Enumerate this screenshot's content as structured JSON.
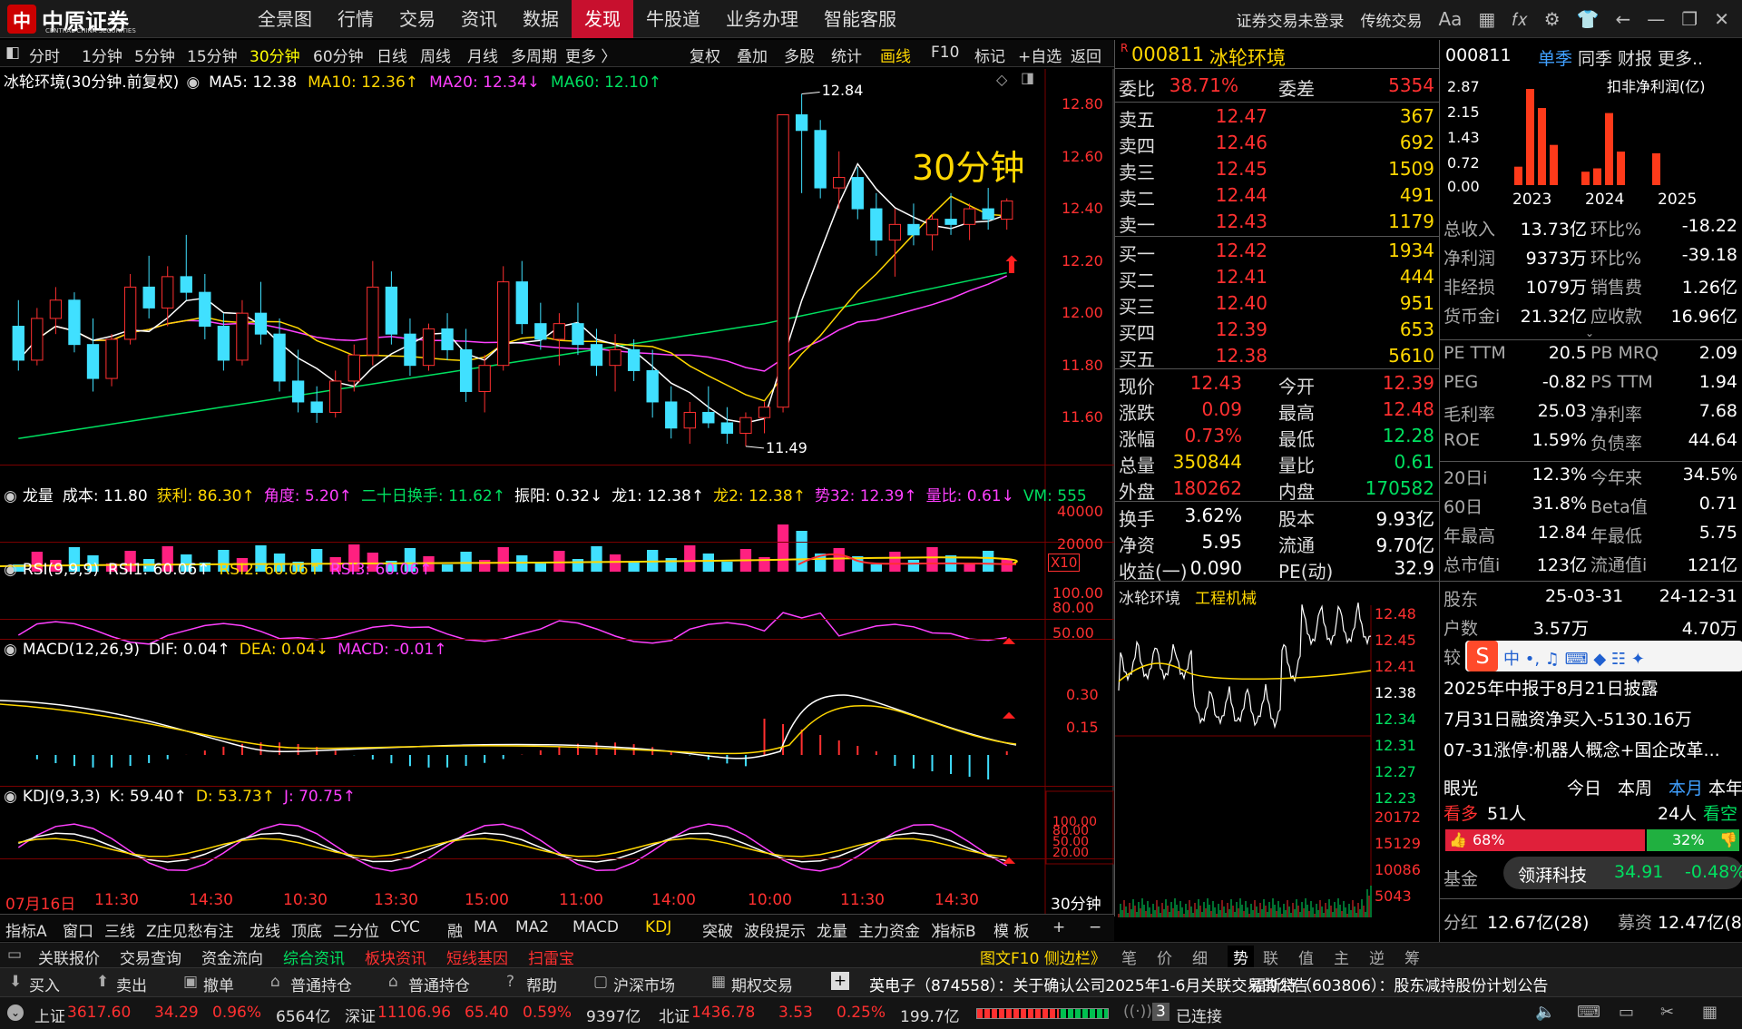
{
  "app": {
    "brand": "中原证券",
    "brand_sub": "CENTRAL CHINA SECURITIES",
    "nav": [
      "全景图",
      "行情",
      "交易",
      "资讯",
      "数据",
      "发现",
      "牛股道",
      "业务办理",
      "智能客服"
    ],
    "nav_active": "发现",
    "login_status": "证券交易未登录",
    "trad_trade": "传统交易",
    "font_btn": "Aa"
  },
  "toolbar": {
    "periods": [
      "分时",
      "1分钟",
      "5分钟",
      "15分钟",
      "30分钟",
      "60分钟",
      "日线",
      "周线",
      "月线",
      "多周期",
      "更多 〉"
    ],
    "active_period": "30分钟",
    "actions": [
      "复权",
      "叠加",
      "多股",
      "统计",
      "画线",
      "F10",
      "标记",
      "+自选",
      "返回"
    ]
  },
  "main_chart": {
    "title": "冰轮环境(30分钟.前复权)",
    "ma": [
      {
        "label": "MA5: 12.38",
        "color": "#ffffff"
      },
      {
        "label": "MA10: 12.36↑",
        "color": "#ffd700"
      },
      {
        "label": "MA20: 12.34↓",
        "color": "#ff40ff"
      },
      {
        "label": "MA60: 12.10↑",
        "color": "#00e060"
      }
    ],
    "overlay_label": "30分钟",
    "high_mark": "12.84",
    "low_mark": "11.49",
    "y_ticks": [
      "12.80",
      "12.60",
      "12.40",
      "12.20",
      "12.00",
      "11.80",
      "11.60"
    ],
    "x_labels": [
      "07月16日",
      "11:30",
      "14:30",
      "10:30",
      "13:30",
      "15:00",
      "11:00",
      "14:00",
      "10:00",
      "11:30",
      "14:30"
    ],
    "period_footer": "30分钟"
  },
  "chart_data": {
    "type": "candlestick",
    "ylim": [
      11.42,
      12.88
    ],
    "ohlc": [
      [
        11.95,
        12.05,
        11.78,
        11.82
      ],
      [
        11.82,
        12.02,
        11.8,
        11.98
      ],
      [
        11.98,
        12.1,
        11.92,
        12.05
      ],
      [
        12.05,
        12.08,
        11.85,
        11.88
      ],
      [
        11.88,
        11.98,
        11.7,
        11.75
      ],
      [
        11.75,
        11.92,
        11.72,
        11.9
      ],
      [
        11.9,
        12.15,
        11.88,
        12.1
      ],
      [
        12.1,
        12.22,
        11.98,
        12.02
      ],
      [
        12.02,
        12.18,
        11.95,
        12.14
      ],
      [
        12.14,
        12.3,
        12.05,
        12.08
      ],
      [
        12.08,
        12.15,
        11.9,
        11.95
      ],
      [
        11.95,
        12.0,
        11.78,
        11.82
      ],
      [
        11.82,
        12.05,
        11.8,
        12.0
      ],
      [
        12.0,
        12.12,
        11.88,
        11.92
      ],
      [
        11.92,
        11.98,
        11.7,
        11.74
      ],
      [
        11.74,
        11.86,
        11.62,
        11.66
      ],
      [
        11.66,
        11.72,
        11.58,
        11.62
      ],
      [
        11.62,
        11.78,
        11.6,
        11.74
      ],
      [
        11.74,
        11.88,
        11.7,
        11.84
      ],
      [
        11.84,
        12.2,
        11.8,
        12.1
      ],
      [
        12.1,
        12.16,
        11.88,
        11.92
      ],
      [
        11.92,
        11.98,
        11.76,
        11.8
      ],
      [
        11.8,
        11.96,
        11.78,
        11.94
      ],
      [
        11.94,
        12.0,
        11.82,
        11.86
      ],
      [
        11.86,
        11.94,
        11.66,
        11.7
      ],
      [
        11.7,
        11.84,
        11.62,
        11.8
      ],
      [
        11.8,
        12.18,
        11.78,
        12.12
      ],
      [
        12.12,
        12.2,
        11.92,
        11.96
      ],
      [
        11.96,
        12.04,
        11.86,
        11.9
      ],
      [
        11.9,
        12.0,
        11.8,
        11.96
      ],
      [
        11.96,
        12.04,
        11.84,
        11.88
      ],
      [
        11.88,
        11.94,
        11.76,
        11.8
      ],
      [
        11.8,
        11.92,
        11.7,
        11.86
      ],
      [
        11.86,
        11.9,
        11.74,
        11.78
      ],
      [
        11.78,
        11.86,
        11.6,
        11.66
      ],
      [
        11.66,
        11.72,
        11.52,
        11.56
      ],
      [
        11.56,
        11.66,
        11.5,
        11.62
      ],
      [
        11.62,
        11.72,
        11.56,
        11.58
      ],
      [
        11.58,
        11.64,
        11.5,
        11.54
      ],
      [
        11.54,
        11.62,
        11.49,
        11.6
      ],
      [
        11.6,
        11.66,
        11.54,
        11.64
      ],
      [
        11.64,
        12.76,
        11.62,
        12.76
      ],
      [
        12.76,
        12.84,
        12.46,
        12.7
      ],
      [
        12.7,
        12.74,
        12.44,
        12.48
      ],
      [
        12.48,
        12.62,
        12.4,
        12.52
      ],
      [
        12.52,
        12.56,
        12.36,
        12.4
      ],
      [
        12.4,
        12.46,
        12.22,
        12.28
      ],
      [
        12.28,
        12.4,
        12.14,
        12.34
      ],
      [
        12.34,
        12.42,
        12.26,
        12.3
      ],
      [
        12.3,
        12.38,
        12.24,
        12.36
      ],
      [
        12.36,
        12.46,
        12.3,
        12.34
      ],
      [
        12.34,
        12.42,
        12.28,
        12.4
      ],
      [
        12.4,
        12.48,
        12.32,
        12.36
      ],
      [
        12.36,
        12.44,
        12.32,
        12.43
      ]
    ]
  },
  "vol_pane": {
    "header": [
      {
        "t": "龙量",
        "c": "#ffffff"
      },
      {
        "t": "成本: 11.80",
        "c": "#ffffff"
      },
      {
        "t": "获利: 86.30↑",
        "c": "#ffd700"
      },
      {
        "t": "角度: 5.20↑",
        "c": "#ff40ff"
      },
      {
        "t": "二十日换手: 11.62↑",
        "c": "#00e060"
      },
      {
        "t": "振阳: 0.32↓",
        "c": "#ffffff"
      },
      {
        "t": "龙1: 12.38↑",
        "c": "#ffffff"
      },
      {
        "t": "龙2: 12.38↑",
        "c": "#ffd700"
      },
      {
        "t": "势32: 12.39↑",
        "c": "#ff40ff"
      },
      {
        "t": "量比: 0.61↓",
        "c": "#ff40ff"
      },
      {
        "t": "VM: 555",
        "c": "#00e060"
      }
    ],
    "y_ticks": [
      "40000",
      "20000"
    ],
    "mult": "X10"
  },
  "rsi_pane": {
    "header": [
      {
        "t": "RSI(9,9,9)",
        "c": "#ffffff"
      },
      {
        "t": "RSI1: 60.06↑",
        "c": "#ffffff"
      },
      {
        "t": "RSI2: 60.06↑",
        "c": "#ffd700"
      },
      {
        "t": "RSI3: 60.06↑",
        "c": "#ff40ff"
      }
    ],
    "y_ticks": [
      "100.00",
      "80.00",
      "50.00"
    ]
  },
  "macd_pane": {
    "header": [
      {
        "t": "MACD(12,26,9)",
        "c": "#ffffff"
      },
      {
        "t": "DIF: 0.04↑",
        "c": "#ffffff"
      },
      {
        "t": "DEA: 0.04↓",
        "c": "#ffd700"
      },
      {
        "t": "MACD: -0.01↑",
        "c": "#ff40ff"
      }
    ],
    "y_ticks": [
      "0.30",
      "0.15"
    ]
  },
  "kdj_pane": {
    "header": [
      {
        "t": "KDJ(9,3,3)",
        "c": "#ffffff"
      },
      {
        "t": "K: 59.40↑",
        "c": "#ffffff"
      },
      {
        "t": "D: 53.73↑",
        "c": "#ffd700"
      },
      {
        "t": "J: 70.75↑",
        "c": "#ff40ff"
      }
    ],
    "y_ticks": [
      "100.00",
      "80.00",
      "50.00",
      "20.00"
    ]
  },
  "bottom_tabs": [
    "指标A",
    "窗口",
    "三线",
    "Z庄见愁有注",
    "龙线",
    "顶底",
    "二分位",
    "CYC",
    "融",
    "MA",
    "MA2",
    "MACD",
    "KDJ",
    "突破",
    "波段提示",
    "龙量",
    "主力资金",
    "〉"
  ],
  "bottom_tabs_active": "KDJ",
  "bottom_right_tabs": [
    "指标B",
    "模 板",
    "+",
    "−"
  ],
  "info_tabs": [
    "关联报价",
    "交易查询",
    "资金流向",
    "综合资讯",
    "板块资讯",
    "短线基因",
    "扫雷宝"
  ],
  "info_right": "图文F10 侧边栏》",
  "tick_tabs": [
    "笔",
    "价",
    "细",
    "势",
    "联",
    "值",
    "主",
    "逆",
    "筹"
  ],
  "tick_tabs_active": "势",
  "trade_bar": [
    "买入",
    "卖出",
    "撤单",
    "普通持仓",
    "普通持仓",
    "帮助",
    "沪深市场",
    "期权交易"
  ],
  "news": [
    "英电子（874558）：关于确认公司2025年1-6月关联交易的公告",
    "福斯特（603806）：股东减持股份计划公告"
  ],
  "status_bar": {
    "sh": {
      "name": "上证",
      "price": "3617.60",
      "chg": "34.29",
      "pct": "0.96%",
      "amt": "6564亿"
    },
    "sz": {
      "name": "深证",
      "price": "11106.96",
      "chg": "65.40",
      "pct": "0.59%",
      "amt": "9397亿"
    },
    "bz": {
      "name": "北证",
      "price": "1436.78",
      "chg": "3.53",
      "pct": "0.25%",
      "amt": "199.7亿"
    },
    "conn_count": "3",
    "conn": "已连接"
  },
  "quote": {
    "code": "000811",
    "name": "冰轮环境",
    "r_badge": "R",
    "weibi_label": "委比",
    "weibi": "38.71%",
    "weicha_label": "委差",
    "weicha": "5354",
    "sell": [
      {
        "l": "卖五",
        "p": "12.47",
        "v": "367"
      },
      {
        "l": "卖四",
        "p": "12.46",
        "v": "692"
      },
      {
        "l": "卖三",
        "p": "12.45",
        "v": "1509"
      },
      {
        "l": "卖二",
        "p": "12.44",
        "v": "491"
      },
      {
        "l": "卖一",
        "p": "12.43",
        "v": "1179"
      }
    ],
    "buy": [
      {
        "l": "买一",
        "p": "12.42",
        "v": "1934"
      },
      {
        "l": "买二",
        "p": "12.41",
        "v": "444"
      },
      {
        "l": "买三",
        "p": "12.40",
        "v": "951"
      },
      {
        "l": "买四",
        "p": "12.39",
        "v": "653"
      },
      {
        "l": "买五",
        "p": "12.38",
        "v": "5610"
      }
    ],
    "stats": [
      {
        "l1": "现价",
        "v1": "12.43",
        "c1": "red",
        "l2": "今开",
        "v2": "12.39",
        "c2": "red"
      },
      {
        "l1": "涨跌",
        "v1": "0.09",
        "c1": "red",
        "l2": "最高",
        "v2": "12.48",
        "c2": "red"
      },
      {
        "l1": "涨幅",
        "v1": "0.73%",
        "c1": "red",
        "l2": "最低",
        "v2": "12.28",
        "c2": "grn"
      },
      {
        "l1": "总量",
        "v1": "350844",
        "c1": "yel",
        "l2": "量比",
        "v2": "0.61",
        "c2": "grn"
      },
      {
        "l1": "外盘",
        "v1": "180262",
        "c1": "red",
        "l2": "内盘",
        "v2": "170582",
        "c2": "grn"
      }
    ],
    "stats2": [
      {
        "l1": "换手",
        "v1": "3.62%",
        "l2": "股本",
        "v2": "9.93亿"
      },
      {
        "l1": "净资",
        "v1": "5.95",
        "l2": "流通",
        "v2": "9.70亿"
      },
      {
        "l1": "收益(一)",
        "v1": "0.090",
        "l2": "PE(动)",
        "v2": "32.9"
      }
    ]
  },
  "ticks": {
    "name": "冰轮环境",
    "sector": "工程机械",
    "price_ticks": [
      "12.48",
      "12.45",
      "12.41",
      "12.38",
      "12.34",
      "12.31",
      "12.27",
      "12.23"
    ],
    "vol_ticks": [
      "20172",
      "15129",
      "10086",
      "5043"
    ]
  },
  "f10": {
    "code": "000811",
    "tabs": [
      "单季",
      "同季",
      "财报",
      "更多.."
    ],
    "chart_title": "扣非净利润(亿)",
    "y_ticks": [
      "2.87",
      "2.15",
      "1.43",
      "0.72",
      "0.00"
    ],
    "years": [
      "2023",
      "2024",
      "2025"
    ],
    "bars": [
      {
        "year": "2023",
        "values": [
          0.55,
          2.87,
          2.3,
          1.2
        ]
      },
      {
        "year": "2024",
        "values": [
          0.4,
          0.5,
          2.15,
          1.0
        ]
      },
      {
        "year": "2025",
        "values": [
          0.95
        ]
      }
    ],
    "rows": [
      {
        "l1": "总收入",
        "v1": "13.73亿",
        "l2": "环比%",
        "v2": "-18.22"
      },
      {
        "l1": "净利润",
        "v1": "9373万",
        "l2": "环比%",
        "v2": "-39.18"
      },
      {
        "l1": "非经损",
        "v1": "1079万",
        "l2": "销售费",
        "v2": "1.26亿"
      },
      {
        "l1": "货币金i",
        "v1": "21.32亿",
        "l2": "应收款",
        "v2": "16.96亿"
      }
    ],
    "rows2": [
      {
        "l1": "PE TTM",
        "v1": "20.5",
        "l2": "PB MRQ",
        "v2": "2.09"
      },
      {
        "l1": "PEG",
        "v1": "-0.82",
        "l2": "PS TTM",
        "v2": "1.94"
      },
      {
        "l1": "毛利率",
        "v1": "25.03",
        "l2": "净利率",
        "v2": "7.68"
      },
      {
        "l1": "ROE",
        "v1": "1.59%",
        "l2": "负债率",
        "v2": "44.64"
      }
    ],
    "rows3": [
      {
        "l1": "20日i",
        "v1": "12.3%",
        "l2": "今年来",
        "v2": "34.5%"
      },
      {
        "l1": "60日",
        "v1": "31.8%",
        "l2": "Beta值",
        "v2": "0.71"
      },
      {
        "l1": "年最高",
        "v1": "12.84",
        "l2": "年最低",
        "v2": "5.75"
      },
      {
        "l1": "总市值i",
        "v1": "123亿",
        "l2": "流通值i",
        "v2": "121亿"
      }
    ],
    "holders": {
      "l": "股东",
      "d1": "25-03-31",
      "d2": "24-12-31"
    },
    "households": {
      "l": "户数",
      "v1": "3.57万",
      "v2": "4.70万"
    },
    "more_label": "较",
    "ime": "中 •, ♫ ⌨ ◆ ☷ ✦",
    "news": [
      "2025年中报于8月21日披露",
      "7月31日融资净买入-5130.16万",
      "07-31涨停:机器人概念+国企改革..."
    ],
    "view": {
      "title": "眼光",
      "tabs": [
        "今日",
        "本周",
        "本月",
        "本年"
      ],
      "active": "本月"
    },
    "bull": {
      "l": "看多",
      "v": "51人",
      "pct": "68%"
    },
    "bear": {
      "l": "看空",
      "v": "24人",
      "pct": "32%"
    },
    "fund_label": "基金",
    "popup": {
      "name": "领湃科技",
      "price": "34.91",
      "chg": "-0.48%"
    },
    "fenhong": {
      "l": "分红",
      "v1": "12.67亿(28)",
      "l2": "募资",
      "v2": "12.47亿(8)"
    }
  }
}
